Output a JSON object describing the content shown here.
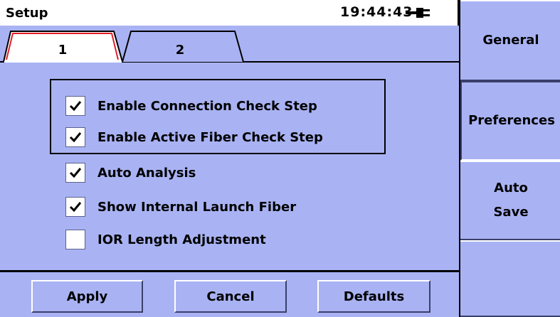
{
  "title_bar": {
    "title": "Setup",
    "time": "19:44:43"
  },
  "tabs": [
    {
      "label": "1",
      "active": true
    },
    {
      "label": "2",
      "active": false
    }
  ],
  "options": [
    {
      "label": "Enable Connection Check Step",
      "checked": true
    },
    {
      "label": "Enable Active Fiber Check Step",
      "checked": true
    },
    {
      "label": "Auto Analysis",
      "checked": true
    },
    {
      "label": "Show Internal Launch Fiber",
      "checked": true
    },
    {
      "label": "IOR Length Adjustment",
      "checked": false
    }
  ],
  "buttons": {
    "apply": "Apply",
    "cancel": "Cancel",
    "defaults": "Defaults"
  },
  "side_menu": {
    "general": "General",
    "preferences": "Preferences",
    "auto_save_line1": "Auto",
    "auto_save_line2": "Save"
  },
  "colors": {
    "background": "#a9b3f3",
    "active_tab_outline": "#e0202a"
  }
}
